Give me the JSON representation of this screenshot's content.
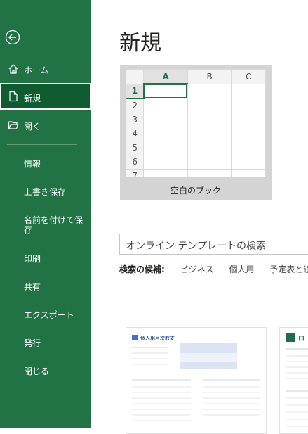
{
  "sidebar": {
    "back_icon": "back-arrow-icon",
    "nav": [
      {
        "label": "ホーム",
        "icon": "home-icon"
      },
      {
        "label": "新規",
        "icon": "new-document-icon"
      },
      {
        "label": "開く",
        "icon": "open-folder-icon"
      }
    ],
    "sub": [
      {
        "label": "情報"
      },
      {
        "label": "上書き保存"
      },
      {
        "label": "名前を付けて保存"
      },
      {
        "label": "印刷"
      },
      {
        "label": "共有"
      },
      {
        "label": "エクスポート"
      },
      {
        "label": "発行"
      },
      {
        "label": "閉じる"
      }
    ]
  },
  "main": {
    "title": "新規",
    "blank_workbook": {
      "label": "空白のブック",
      "columns": [
        "A",
        "B",
        "C"
      ],
      "rows": [
        "1",
        "2",
        "3",
        "4",
        "5",
        "6",
        "7"
      ]
    },
    "search": {
      "placeholder": "オンライン テンプレートの検索"
    },
    "suggestions": {
      "lead": "検索の候補:",
      "items": [
        "ビジネス",
        "個人用",
        "予定表と追跡"
      ]
    },
    "templates": [
      {
        "title": "個人用月次収支"
      },
      {
        "title": "ロ"
      }
    ]
  },
  "colors": {
    "accent": "#217346",
    "sidebar_active": "#0e5c2f"
  }
}
